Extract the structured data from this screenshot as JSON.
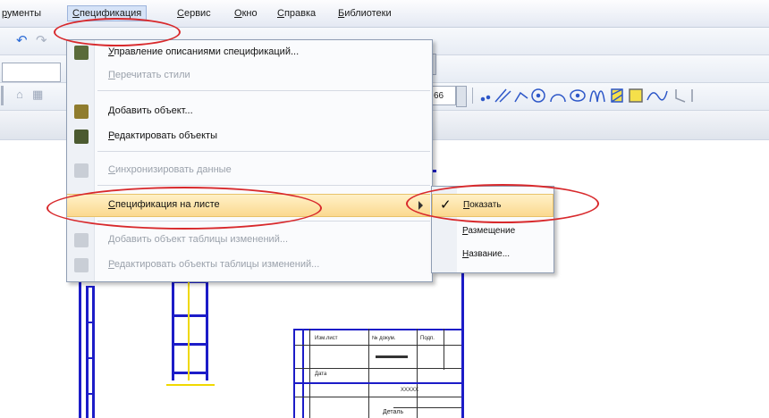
{
  "menubar": {
    "items": [
      {
        "label": "рументы"
      },
      {
        "label": "Спецификация"
      },
      {
        "label": "Сервис"
      },
      {
        "label": "Окно"
      },
      {
        "label": "Справка"
      },
      {
        "label": "Библиотеки"
      }
    ]
  },
  "toolbar": {
    "zoom_value": "66"
  },
  "menu": {
    "items": [
      {
        "label": "Управление описаниями спецификаций...",
        "icon": "spec-manager-icon",
        "disabled": false
      },
      {
        "label": "Перечитать стили",
        "icon": "",
        "disabled": true
      },
      {
        "label": "Добавить объект...",
        "icon": "add-object-icon",
        "disabled": false
      },
      {
        "label": "Редактировать объекты",
        "icon": "edit-objects-icon",
        "disabled": false
      },
      {
        "label": "Синхронизировать данные",
        "icon": "sync-data-icon",
        "disabled": true
      },
      {
        "label": "Спецификация на листе",
        "icon": "",
        "disabled": false
      },
      {
        "label": "Добавить объект таблицы изменений...",
        "icon": "add-change-table-icon",
        "disabled": true
      },
      {
        "label": "Редактировать объекты таблицы изменений...",
        "icon": "edit-change-table-icon",
        "disabled": true
      }
    ]
  },
  "submenu": {
    "items": [
      {
        "label": "Показать",
        "checked": true
      },
      {
        "label": "Размещение",
        "checked": false
      },
      {
        "label": "Название...",
        "checked": false
      }
    ]
  },
  "drawing": {
    "stamp_cells": [
      "Изм.лист",
      "№ докум.",
      "Подп.",
      "Дата",
      "ХХХХХ",
      "Деталь"
    ]
  },
  "colors": {
    "annotation": "#d8292c",
    "highlight": "#fbd98f",
    "frame": "#1c1cc8"
  }
}
